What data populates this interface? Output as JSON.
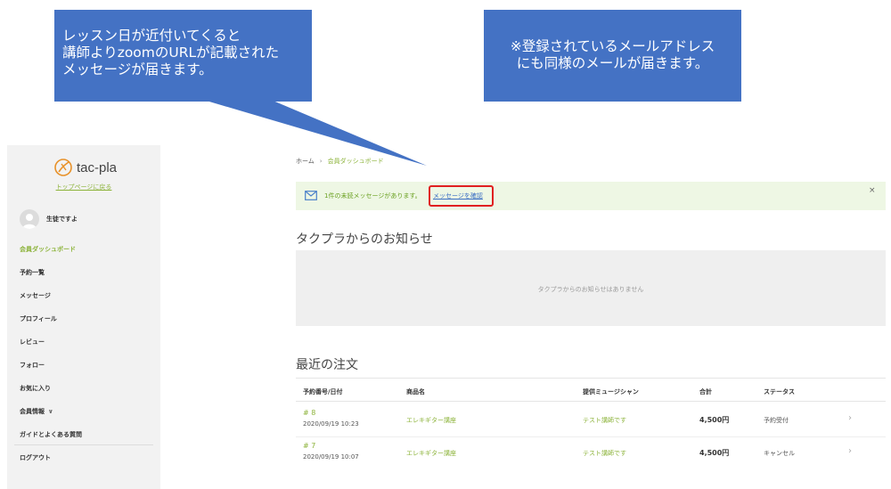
{
  "callouts": {
    "left": [
      "レッスン日が近付いてくると",
      "講師よりzoomのURLが記載された",
      "メッセージが届きます。"
    ],
    "right": [
      "※登録されているメールアドレス",
      "にも同様のメールが届きます。"
    ]
  },
  "sidebar": {
    "logo_text": "tac-pla",
    "top_link": "トップページに戻る",
    "user_name": "生徒ですよ",
    "items": [
      {
        "label": "会員ダッシュボード",
        "active": true
      },
      {
        "label": "予約一覧"
      },
      {
        "label": "メッセージ"
      },
      {
        "label": "プロフィール"
      },
      {
        "label": "レビュー"
      },
      {
        "label": "フォロー"
      },
      {
        "label": "お気に入り"
      },
      {
        "label": "会員情報"
      },
      {
        "label": "ガイドとよくある質問"
      },
      {
        "label": "ログアウト"
      }
    ]
  },
  "breadcrumb": {
    "home": "ホーム",
    "separator": "›",
    "current": "会員ダッシュボード"
  },
  "notice": {
    "text": "1件の未読メッセージがあります。",
    "link": "メッセージを確認",
    "close": "×"
  },
  "news": {
    "title": "タクプラからのお知らせ",
    "empty": "タクプラからのお知らせはありません"
  },
  "orders": {
    "title": "最近の注文",
    "headers": [
      "予約番号/日付",
      "商品名",
      "提供ミュージシャン",
      "合計",
      "ステータス"
    ],
    "rows": [
      {
        "no": "# 8",
        "date": "2020/09/19 10:23",
        "product": "エレキギター講座",
        "musician": "テスト講師です",
        "total": "4,500円",
        "status": "予約受付"
      },
      {
        "no": "# 7",
        "date": "2020/09/19 10:07",
        "product": "エレキギター講座",
        "musician": "テスト講師です",
        "total": "4,500円",
        "status": "キャンセル"
      }
    ]
  },
  "colors": {
    "callout": "#4472c4",
    "accent": "#8cb33a",
    "highlight": "#e02020",
    "notice_bg": "#eef7e4"
  }
}
